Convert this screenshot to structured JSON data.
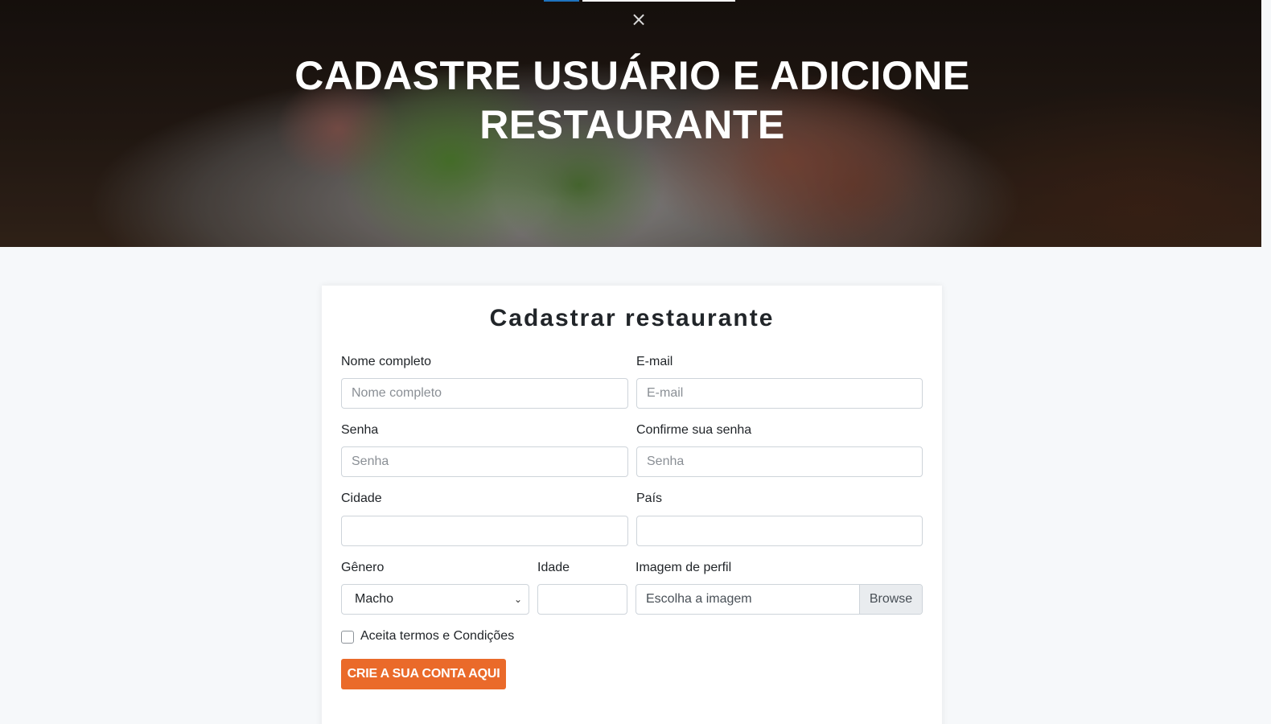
{
  "hero": {
    "title_line1": "CADASTRE USUÁRIO E ADICIONE",
    "title_line2": "RESTAURANTE",
    "close_icon": "×"
  },
  "form": {
    "title": "Cadastrar restaurante",
    "full_name": {
      "label": "Nome completo",
      "placeholder": "Nome completo",
      "value": ""
    },
    "email": {
      "label": "E-mail",
      "placeholder": "E-mail",
      "value": ""
    },
    "password": {
      "label": "Senha",
      "placeholder": "Senha",
      "value": ""
    },
    "confirm_password": {
      "label": "Confirme sua senha",
      "placeholder": "Senha",
      "value": ""
    },
    "city": {
      "label": "Cidade",
      "placeholder": "",
      "value": ""
    },
    "country": {
      "label": "País",
      "placeholder": "",
      "value": ""
    },
    "gender": {
      "label": "Gênero",
      "selected": "Macho"
    },
    "age": {
      "label": "Idade",
      "value": ""
    },
    "profile_image": {
      "label": "Imagem de perfil",
      "placeholder": "Escolha a imagem",
      "button": "Browse"
    },
    "terms": {
      "label": "Aceita termos e Condições",
      "checked": false
    },
    "submit_label": "CRIE A SUA CONTA AQUI"
  },
  "colors": {
    "accent": "#ea6a2a",
    "page_background": "#f6f8fa",
    "hero_highlight": "#1e73be"
  },
  "icons": {
    "close": "close-icon",
    "select_chevron": "chevron-down-icon"
  }
}
